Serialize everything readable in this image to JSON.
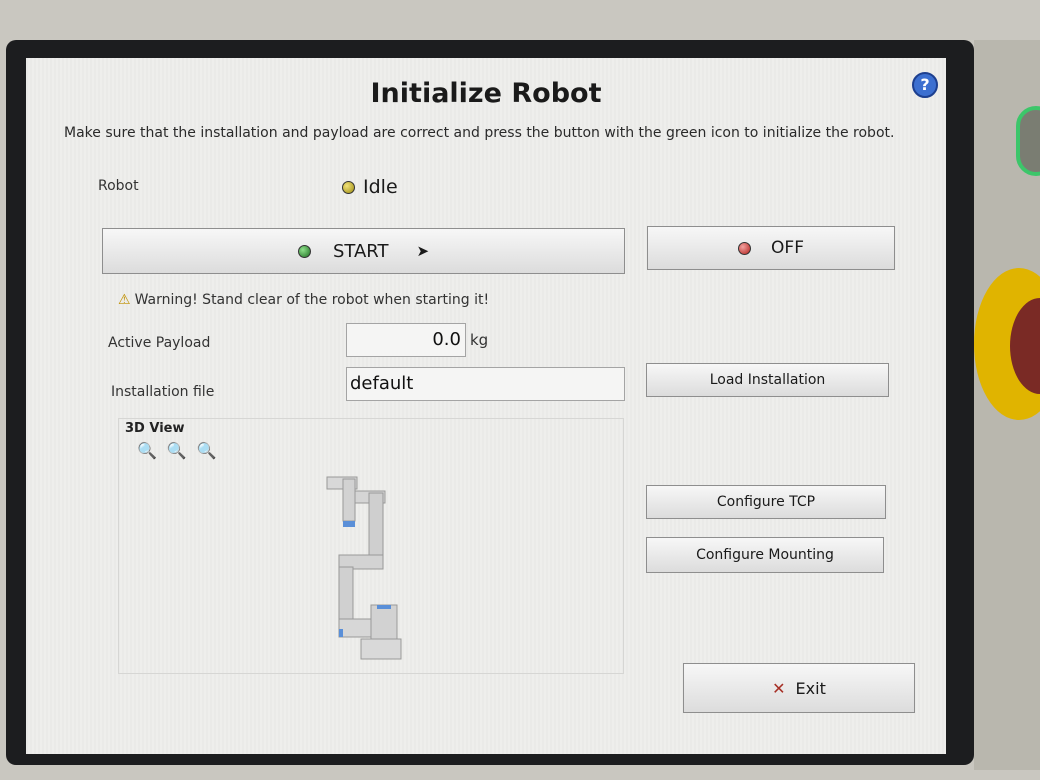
{
  "screen": {
    "title": "Initialize Robot",
    "subtitle": "Make sure that the installation and payload are correct and press the button with the green icon to initialize the robot.",
    "help_icon": "question-mark-icon"
  },
  "robot_status": {
    "label": "Robot",
    "state": "Idle",
    "state_color": "#c9b01a"
  },
  "buttons": {
    "start_label": "START",
    "start_icon_color": "#2e8b30",
    "off_label": "OFF",
    "off_icon_color": "#c0241f",
    "load_installation_label": "Load Installation",
    "configure_tcp_label": "Configure TCP",
    "configure_mounting_label": "Configure Mounting",
    "exit_label": "Exit"
  },
  "warning": {
    "text": "Warning! Stand clear of the robot when starting it!"
  },
  "payload": {
    "label": "Active Payload",
    "value": "0.0",
    "unit": "kg"
  },
  "installation": {
    "label": "Installation file",
    "value": "default"
  },
  "view3d": {
    "label": "3D View",
    "zoom_icons": [
      "zoom-in-icon",
      "zoom-reset-icon",
      "zoom-out-icon"
    ]
  }
}
